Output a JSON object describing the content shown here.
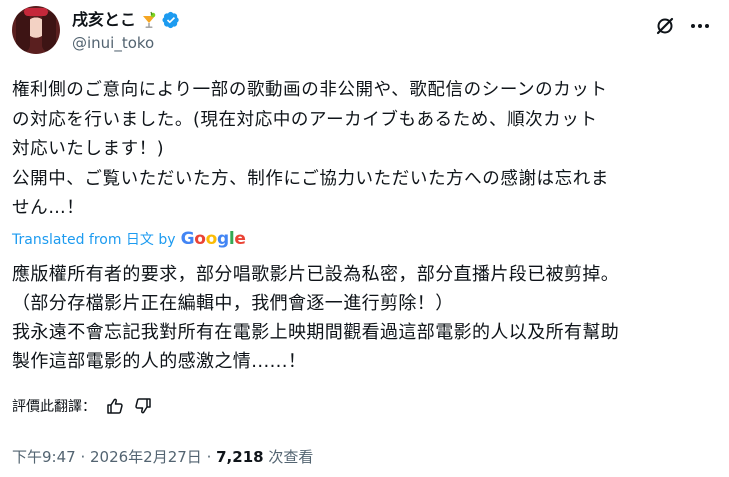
{
  "author": {
    "display_name": "戌亥とこ",
    "handle": "@inui_toko"
  },
  "tweet": {
    "original_lines": [
      "権利側のご意向により一部の歌動画の非公開や、歌配信のシーンのカット",
      "の対応を行いました。(現在対応中のアーカイブもあるため、順次カット",
      "対応いたします！)",
      "公開中、ご覧いただいた方、制作にご協力いただいた方への感謝は忘れま",
      "せん…！"
    ],
    "translated_from_label": "Translated from 日文 by",
    "translator": "Google",
    "translated_lines": [
      "應版權所有者的要求，部分唱歌影片已設為私密，部分直播片段已被剪掉。",
      "（部分存檔影片正在編輯中，我們會逐一進行剪除！）",
      "我永遠不會忘記我對所有在電影上映期間觀看過這部電影的人以及所有幫助",
      "製作這部電影的人的感激之情......！"
    ],
    "rate_translation_label": "評價此翻譯：",
    "time": "下午9:47",
    "date": "2026年2月27日",
    "separator": " · ",
    "views_count": "7,218",
    "views_label": "次查看"
  },
  "colors": {
    "accent": "#1d9bf0",
    "secondary_text": "#536471",
    "primary_text": "#0f1419"
  },
  "icons": {
    "verified": "verified-badge-icon",
    "emoji": "cocktail-emoji-icon",
    "grok": "grok-icon",
    "more": "more-horizontal-icon",
    "thumbs_up": "thumbs-up-icon",
    "thumbs_down": "thumbs-down-icon"
  }
}
